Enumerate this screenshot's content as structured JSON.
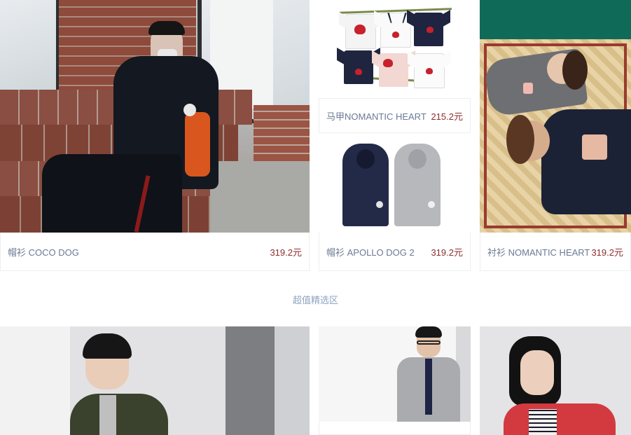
{
  "products_top": [
    {
      "name": "帽衫 COCO DOG",
      "price": "319.2元"
    },
    {
      "name": "马甲NOMANTIC HEART",
      "price": "215.2元"
    },
    {
      "name": "帽衫 APOLLO DOG 2",
      "price": "319.2元"
    },
    {
      "name": "衬衫 NOMANTIC HEART",
      "price": "319.2元"
    }
  ],
  "section": {
    "title": "超值精选区"
  },
  "colors": {
    "caption_text": "#6b7a95",
    "price": "#8b2d2d",
    "section_title": "#8fa3c0",
    "border": "#eeeeee"
  },
  "images": {
    "p1": "photo-man-hoodie-on-steps",
    "p2": "photo-six-tshirts",
    "p3": "photo-two-hoodies",
    "p4": "photo-couple-on-rug",
    "p5": "photo-man-green-jacket",
    "p6": "photo-man-grey-shirt",
    "p7": "photo-woman-red-jacket"
  }
}
